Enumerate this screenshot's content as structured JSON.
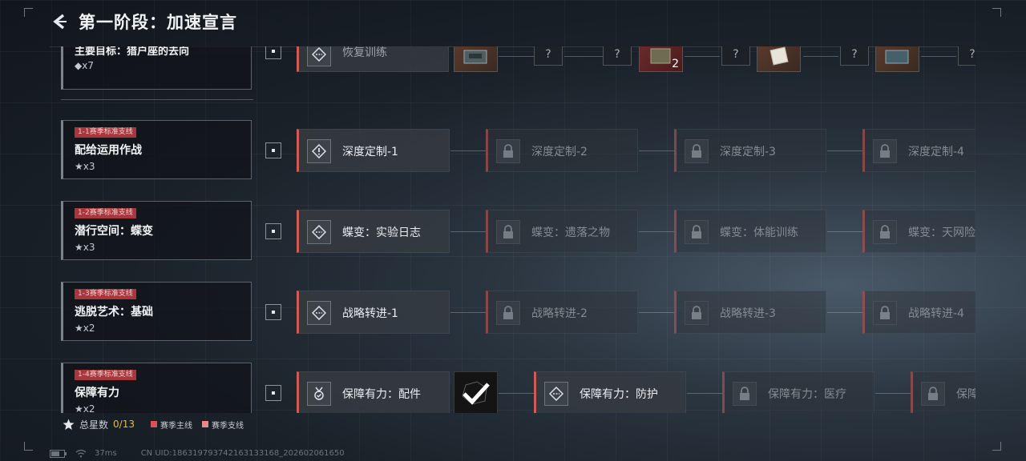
{
  "header": {
    "title": "第一阶段：加速宣言"
  },
  "main_goal": {
    "name": "主要目标：猎户座的去向",
    "stars": "◆x7"
  },
  "main_row": {
    "task_label": "恢复训练",
    "reward_count": "2",
    "locked_symbol": "?"
  },
  "branches": [
    {
      "tag": "1-1赛季标准支线",
      "name": "配给运用作战",
      "stars": "★x3",
      "tasks": [
        {
          "label": "深度定制-1",
          "state": "unlocked",
          "icon": "alert-diamond-icon"
        },
        {
          "label": "深度定制-2",
          "state": "locked",
          "icon": "lock-icon"
        },
        {
          "label": "深度定制-3",
          "state": "locked",
          "icon": "lock-icon"
        },
        {
          "label": "深度定制-4",
          "state": "locked",
          "icon": "lock-icon"
        }
      ]
    },
    {
      "tag": "1-2赛季标准支线",
      "name": "潜行空间：蝶变",
      "stars": "★x3",
      "tasks": [
        {
          "label": "蝶变：实验日志",
          "state": "unlocked",
          "icon": "dash-diamond-icon"
        },
        {
          "label": "蝶变：遗落之物",
          "state": "locked",
          "icon": "lock-icon"
        },
        {
          "label": "蝶变：体能训练",
          "state": "locked",
          "icon": "lock-icon"
        },
        {
          "label": "蝶变：天网险",
          "state": "locked",
          "icon": "lock-icon"
        }
      ]
    },
    {
      "tag": "1-3赛季标准支线",
      "name": "逃脱艺术：基础",
      "stars": "★x2",
      "tasks": [
        {
          "label": "战略转进-1",
          "state": "unlocked",
          "icon": "dash-diamond-icon"
        },
        {
          "label": "战略转进-2",
          "state": "locked",
          "icon": "lock-icon"
        },
        {
          "label": "战略转进-3",
          "state": "locked",
          "icon": "lock-icon"
        },
        {
          "label": "战略转进-4",
          "state": "locked",
          "icon": "lock-icon"
        }
      ]
    },
    {
      "tag": "1-4赛季标准支线",
      "name": "保障有力",
      "stars": "★x2",
      "tasks": [
        {
          "label": "保障有力：配件",
          "state": "unlocked",
          "icon": "medal-icon"
        },
        {
          "label": "保障有力：防护",
          "state": "unlocked",
          "icon": "dash-diamond-icon"
        },
        {
          "label": "保障有力：医疗",
          "state": "locked",
          "icon": "lock-icon"
        },
        {
          "label": "保障",
          "state": "locked",
          "icon": "lock-icon"
        }
      ]
    }
  ],
  "legend": {
    "total_label": "总星数",
    "total_value": "0/13",
    "main_line": "赛季主线",
    "side_line": "赛季支线",
    "main_color": "#d9534f",
    "side_color": "#e88a80"
  },
  "status": {
    "ping": "37ms",
    "uid": "CN UID:186319793742163133168_202602061650"
  }
}
